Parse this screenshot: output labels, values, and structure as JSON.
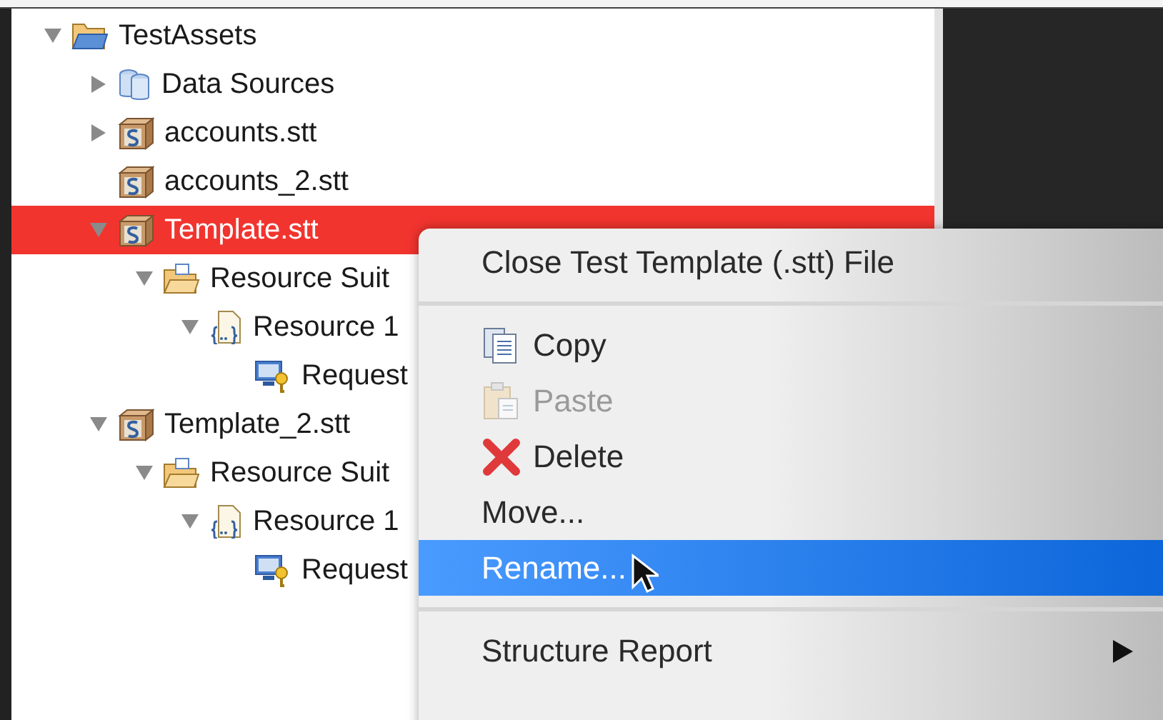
{
  "tree": [
    {
      "label": "TestAssets",
      "kind": "folder",
      "expanded": true,
      "selected": false,
      "children": [
        {
          "label": "Data Sources",
          "kind": "datasource",
          "expanded": false,
          "selected": false
        },
        {
          "label": "accounts.stt",
          "kind": "stt",
          "expanded": false,
          "selected": false
        },
        {
          "label": "accounts_2.stt",
          "kind": "stt",
          "selected": false
        },
        {
          "label": "Template.stt",
          "kind": "stt",
          "expanded": true,
          "selected": true,
          "children": [
            {
              "label": "Resource Suit",
              "kind": "suite",
              "expanded": true,
              "selected": false,
              "children": [
                {
                  "label": "Resource 1",
                  "kind": "resource",
                  "expanded": true,
                  "selected": false,
                  "children": [
                    {
                      "label": "Request",
                      "kind": "request",
                      "selected": false
                    }
                  ]
                }
              ]
            }
          ]
        },
        {
          "label": "Template_2.stt",
          "kind": "stt",
          "expanded": true,
          "selected": false,
          "children": [
            {
              "label": "Resource Suit",
              "kind": "suite",
              "expanded": true,
              "selected": false,
              "children": [
                {
                  "label": "Resource 1",
                  "kind": "resource",
                  "expanded": true,
                  "selected": false,
                  "children": [
                    {
                      "label": "Request",
                      "kind": "request",
                      "selected": false
                    }
                  ]
                }
              ]
            }
          ]
        }
      ]
    }
  ],
  "context_menu": [
    {
      "kind": "item",
      "label": "Close Test Template (.stt) File",
      "selected": false,
      "disabled": false
    },
    {
      "kind": "separator"
    },
    {
      "kind": "copy",
      "label": "Copy",
      "selected": false,
      "disabled": false
    },
    {
      "kind": "paste",
      "label": "Paste",
      "selected": false,
      "disabled": true
    },
    {
      "kind": "delete",
      "label": "Delete",
      "selected": false,
      "disabled": false
    },
    {
      "kind": "item",
      "label": "Move...",
      "selected": false,
      "disabled": false
    },
    {
      "kind": "item",
      "label": "Rename...",
      "selected": true,
      "disabled": false
    },
    {
      "kind": "separator"
    },
    {
      "kind": "submenu",
      "label": "Structure Report",
      "selected": false,
      "disabled": false
    }
  ]
}
